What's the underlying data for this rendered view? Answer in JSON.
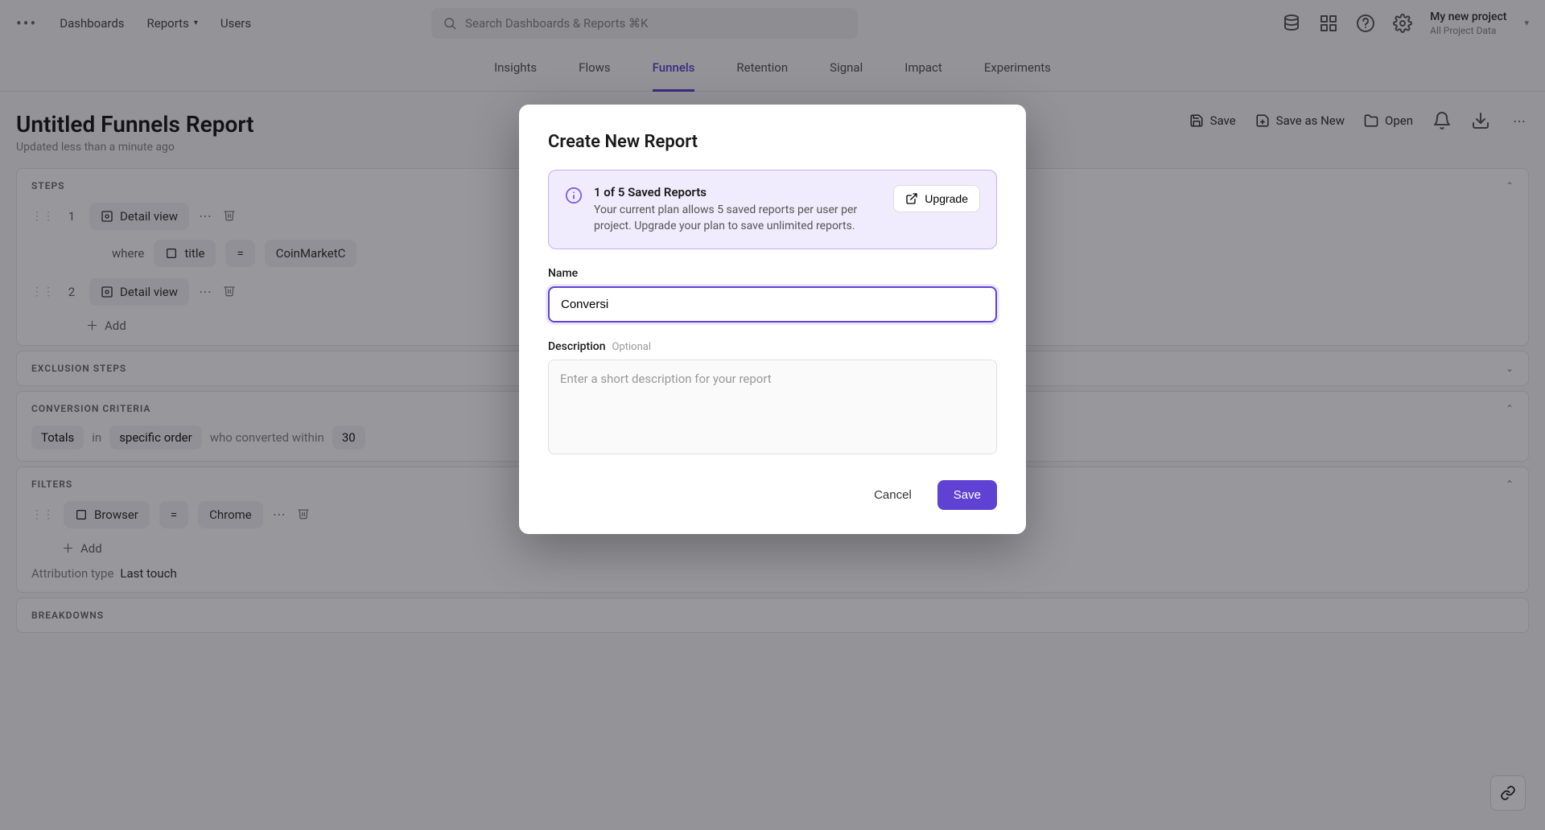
{
  "topnav": {
    "dashboards": "Dashboards",
    "reports": "Reports",
    "users": "Users",
    "search_placeholder": "Search Dashboards & Reports ⌘K",
    "project_name": "My new project",
    "project_sub": "All Project Data"
  },
  "subtabs": [
    "Insights",
    "Flows",
    "Funnels",
    "Retention",
    "Signal",
    "Impact",
    "Experiments"
  ],
  "subtab_active": 2,
  "title": {
    "text": "Untitled Funnels Report",
    "sub": "Updated less than a minute ago"
  },
  "actions": {
    "save": "Save",
    "save_as_new": "Save as New",
    "open": "Open"
  },
  "steps": {
    "title": "STEPS",
    "rows": [
      {
        "num": "1",
        "chip": "Detail view",
        "where": {
          "label": "where",
          "prop": "title",
          "op": "=",
          "value": "CoinMarketC"
        }
      },
      {
        "num": "2",
        "chip": "Detail view"
      }
    ],
    "add": "Add"
  },
  "exclusion": {
    "title": "EXCLUSION STEPS"
  },
  "criteria": {
    "title": "CONVERSION CRITERIA",
    "totals": "Totals",
    "in": "in",
    "order": "specific order",
    "who": "who converted within",
    "window": "30"
  },
  "filters": {
    "title": "FILTERS",
    "prop": "Browser",
    "op": "=",
    "value": "Chrome",
    "add": "Add",
    "attr_label": "Attribution type",
    "attr_value": "Last touch"
  },
  "breakdowns": {
    "title": "BREAKDOWNS"
  },
  "modal": {
    "title": "Create New Report",
    "plan_title": "1 of 5 Saved Reports",
    "plan_body": "Your current plan allows 5 saved reports per user per project. Upgrade your plan to save unlimited reports.",
    "upgrade": "Upgrade",
    "name_label": "Name",
    "name_value": "Conversi",
    "desc_label": "Description",
    "desc_optional": "Optional",
    "desc_placeholder": "Enter a short description for your report",
    "cancel": "Cancel",
    "save": "Save"
  }
}
